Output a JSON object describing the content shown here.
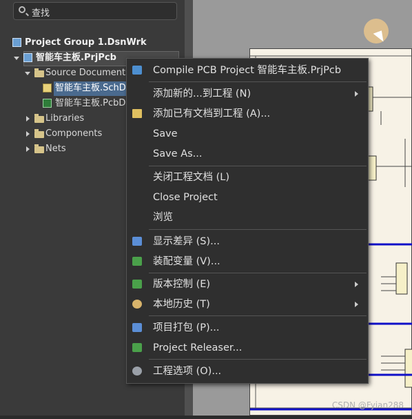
{
  "search": {
    "placeholder": "查找"
  },
  "tree": {
    "group": "Project Group 1.DsnWrk",
    "project": "智能车主板.PrjPcb",
    "source_documents": "Source Documents",
    "sch_doc": "智能车主板.SchD",
    "pcb_doc": "智能车主板.PcbD",
    "libraries": "Libraries",
    "components": "Components",
    "nets": "Nets"
  },
  "menu": {
    "compile": "Compile PCB Project 智能车主板.PrjPcb",
    "add_new": "添加新的...到工程 (N)",
    "add_existing": "添加已有文档到工程 (A)...",
    "save": "Save",
    "save_as": "Save As...",
    "close_docs": "关闭工程文档 (L)",
    "close_project": "Close Project",
    "browse": "浏览",
    "show_diff": "显示差异 (S)...",
    "variants": "装配变量 (V)...",
    "version_control": "版本控制 (E)",
    "local_history": "本地历史 (T)",
    "packaging": "项目打包 (P)...",
    "releaser": "Project Releaser...",
    "options": "工程选项 (O)..."
  },
  "watermark": "CSDN @Fyian288",
  "colors": {
    "panel_bg": "#3a3a3a",
    "menu_bg": "#2f2f2f",
    "selection": "#4a6a8e",
    "wire_blue": "#1010c8"
  }
}
